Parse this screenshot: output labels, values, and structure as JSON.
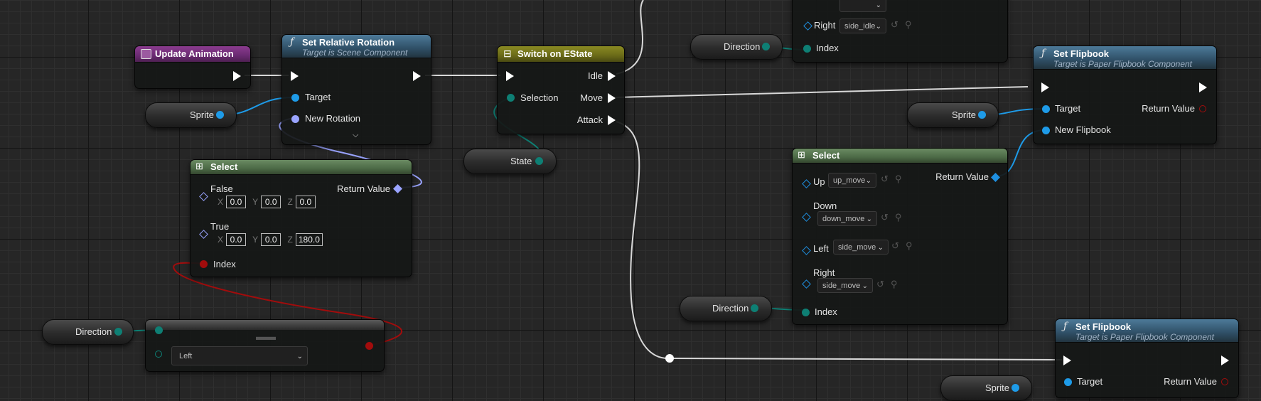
{
  "nodes": {
    "update_animation": {
      "title": "Update Animation"
    },
    "set_relative_rotation": {
      "title": "Set Relative Rotation",
      "subtitle": "Target is Scene Component",
      "target": "Target",
      "new_rotation": "New Rotation"
    },
    "switch_estate": {
      "title": "Switch on EState",
      "selection": "Selection",
      "idle": "Idle",
      "move": "Move",
      "attack": "Attack"
    },
    "select_rot": {
      "title": "Select",
      "return_value": "Return Value",
      "index": "Index",
      "false_label": "False",
      "true_label": "True",
      "false_vals": {
        "x": "0.0",
        "y": "0.0",
        "z": "0.0"
      },
      "true_vals": {
        "x": "0.0",
        "y": "0.0",
        "z": "180.0"
      },
      "axis": {
        "x": "X",
        "y": "Y",
        "z": "Z"
      }
    },
    "select_top": {
      "right": "Right",
      "right_value": "side_idle",
      "index": "Index"
    },
    "select_move": {
      "title": "Select",
      "return_value": "Return Value",
      "index": "Index",
      "up": "Up",
      "up_value": "up_move",
      "down": "Down",
      "down_value": "down_move",
      "left": "Left",
      "left_value": "side_move",
      "right": "Right",
      "right_value": "side_move"
    },
    "set_flipbook_1": {
      "title": "Set Flipbook",
      "subtitle": "Target is Paper Flipbook Component",
      "target": "Target",
      "new_flipbook": "New Flipbook",
      "return_value": "Return Value"
    },
    "set_flipbook_2": {
      "title": "Set Flipbook",
      "subtitle": "Target is Paper Flipbook Component",
      "target": "Target",
      "return_value": "Return Value"
    },
    "enum_equal": {
      "value": "Left"
    }
  },
  "variables": {
    "sprite_1": "Sprite",
    "sprite_2": "Sprite",
    "sprite_3": "Sprite",
    "state": "State",
    "direction_1": "Direction",
    "direction_2": "Direction",
    "direction_3": "Direction"
  },
  "colors": {
    "exec": "#ffffff",
    "object_pin": "#1e9be8",
    "enum_pin": "#0e7f74",
    "bool_pin": "#a20c0c",
    "struct_pin": "#9aa4ff",
    "wire": "#d8d8d8"
  }
}
